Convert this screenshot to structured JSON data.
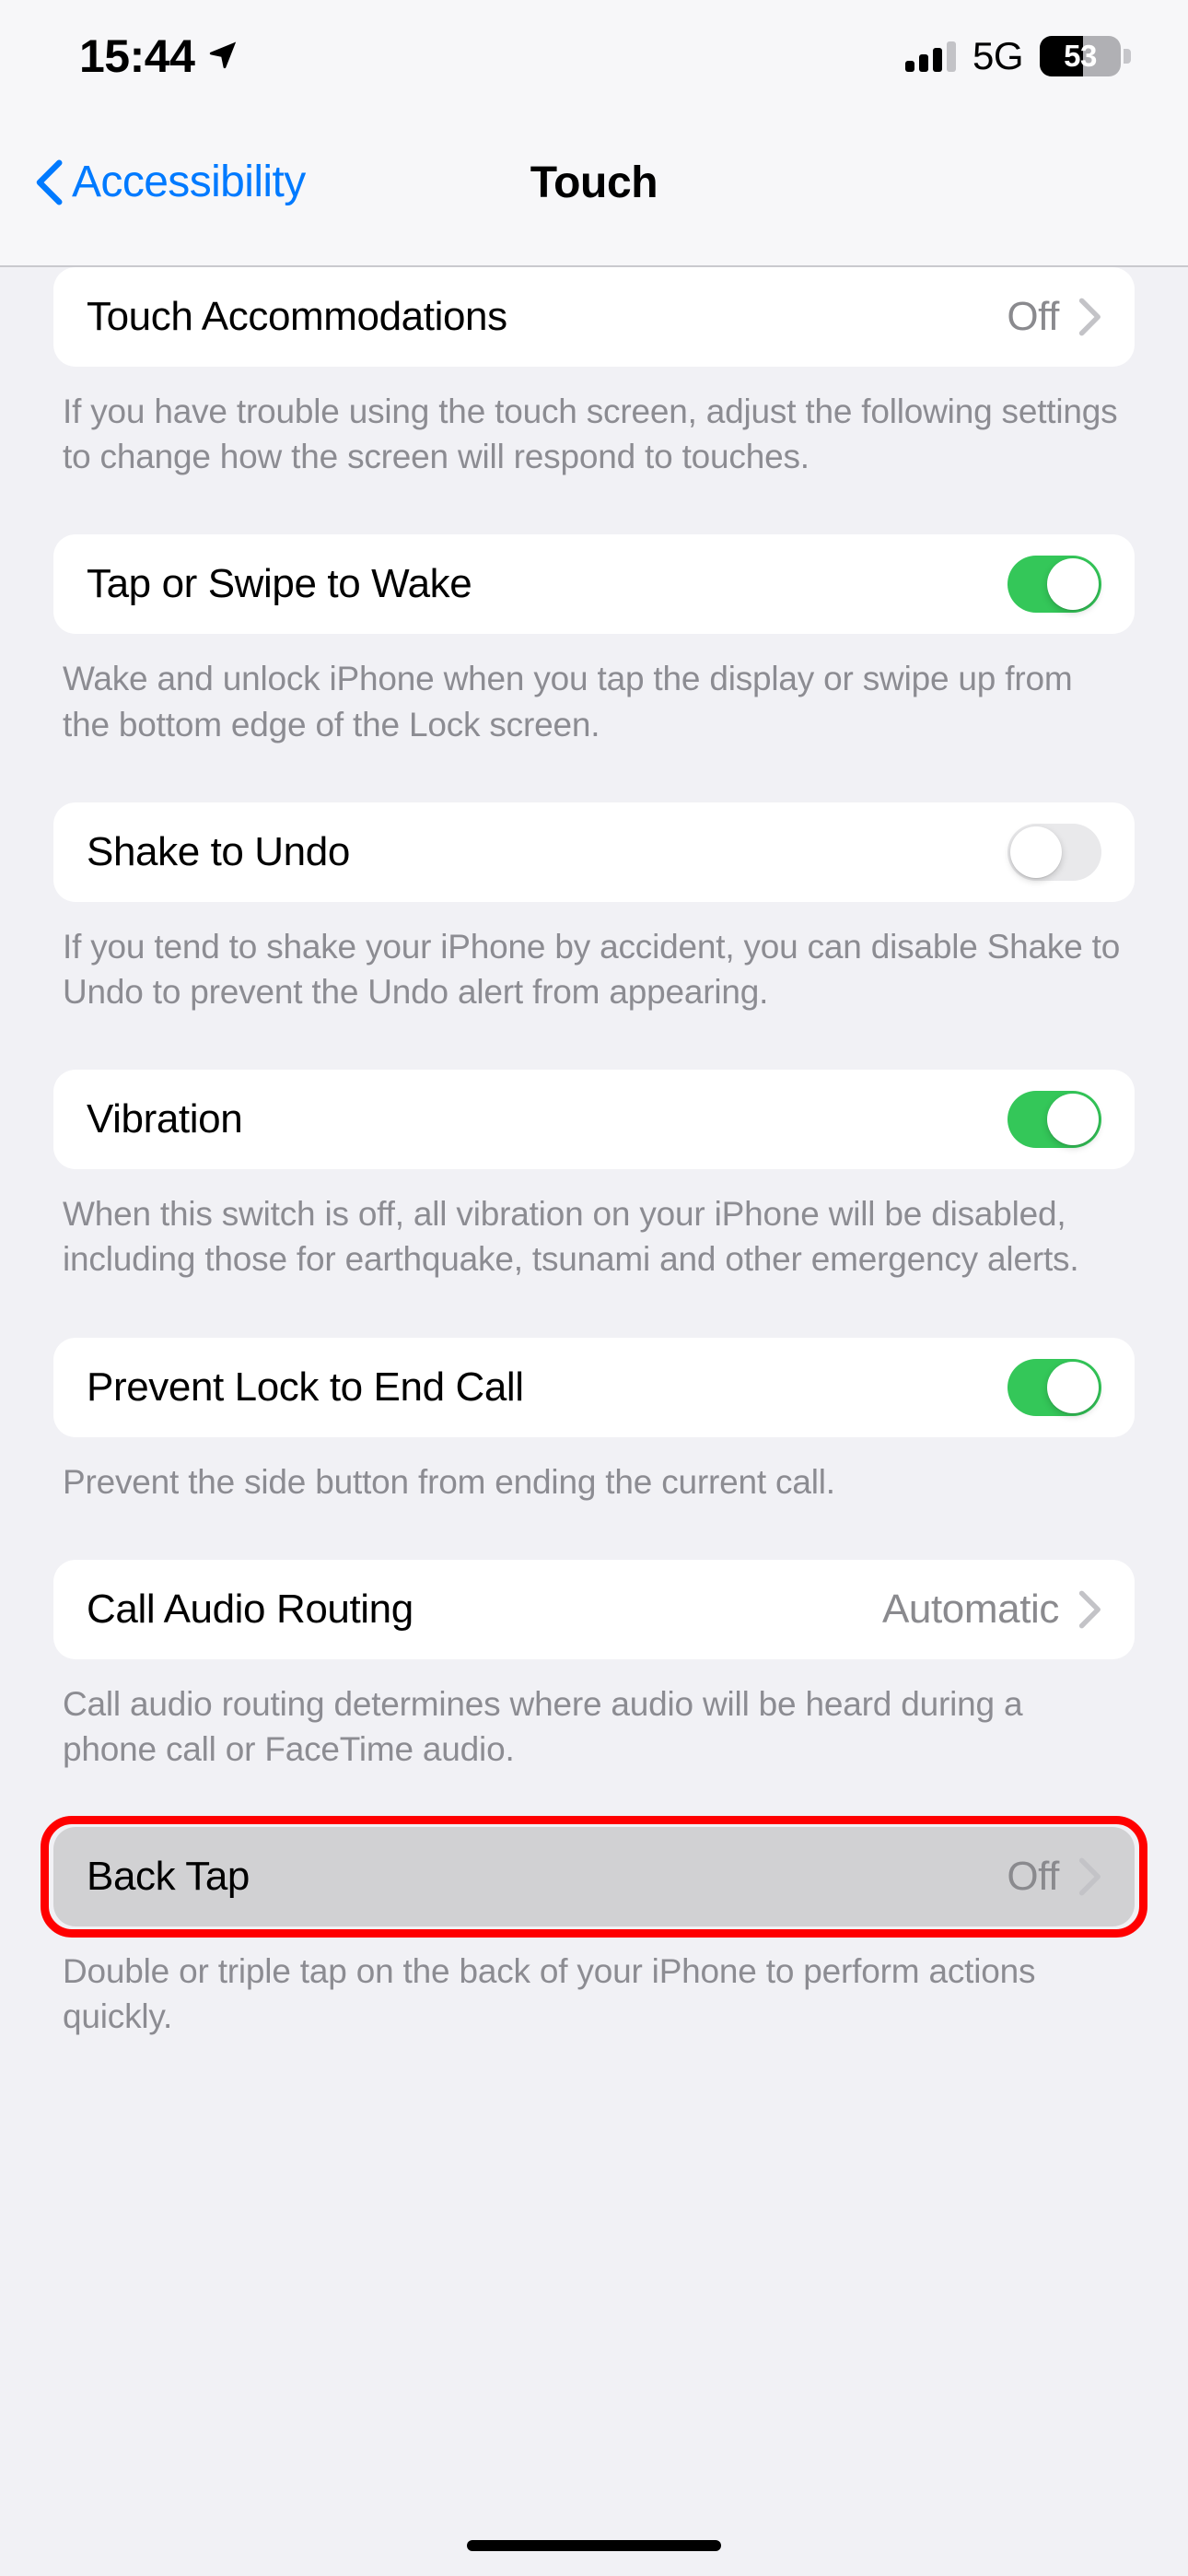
{
  "status_bar": {
    "time": "15:44",
    "location_icon": "location-arrow-icon",
    "signal_icon": "cellular-signal-icon",
    "signal_bars_filled": 3,
    "signal_bars_total": 4,
    "network": "5G",
    "battery_percent": "53",
    "battery_level": 53,
    "battery_icon": "battery-icon"
  },
  "nav": {
    "back_label": "Accessibility",
    "back_icon": "chevron-left-icon",
    "title": "Touch"
  },
  "colors": {
    "accent_blue": "#007AFF",
    "toggle_on_green": "#34C759",
    "toggle_off_gray": "#E9E9EB",
    "highlight_red": "#FF0000",
    "page_background": "#F1F1F5",
    "card_background": "#FFFFFF",
    "highlight_row_background": "#D1D1D3",
    "secondary_text": "#8A8A8E"
  },
  "sections": [
    {
      "row": {
        "label": "Touch Accommodations",
        "type": "disclosure",
        "value": "Off",
        "chevron_icon": "chevron-right-icon"
      },
      "footnote": "If you have trouble using the touch screen, adjust the following settings to change how the screen will respond to touches."
    },
    {
      "row": {
        "label": "Tap or Swipe to Wake",
        "type": "toggle",
        "toggle_state": "on"
      },
      "footnote": "Wake and unlock iPhone when you tap the display or swipe up from the bottom edge of the Lock screen."
    },
    {
      "row": {
        "label": "Shake to Undo",
        "type": "toggle",
        "toggle_state": "off"
      },
      "footnote": "If you tend to shake your iPhone by accident, you can disable Shake to Undo to prevent the Undo alert from appearing."
    },
    {
      "row": {
        "label": "Vibration",
        "type": "toggle",
        "toggle_state": "on"
      },
      "footnote": "When this switch is off, all vibration on your iPhone will be disabled, including those for earthquake, tsunami and other emergency alerts."
    },
    {
      "row": {
        "label": "Prevent Lock to End Call",
        "type": "toggle",
        "toggle_state": "on"
      },
      "footnote": "Prevent the side button from ending the current call."
    },
    {
      "row": {
        "label": "Call Audio Routing",
        "type": "disclosure",
        "value": "Automatic",
        "chevron_icon": "chevron-right-icon"
      },
      "footnote": "Call audio routing determines where audio will be heard during a phone call or FaceTime audio."
    },
    {
      "row": {
        "label": "Back Tap",
        "type": "disclosure",
        "value": "Off",
        "chevron_icon": "chevron-right-icon",
        "highlighted": true
      },
      "footnote": "Double or triple tap on the back of your iPhone to perform actions quickly."
    }
  ],
  "home_indicator": "home-indicator"
}
